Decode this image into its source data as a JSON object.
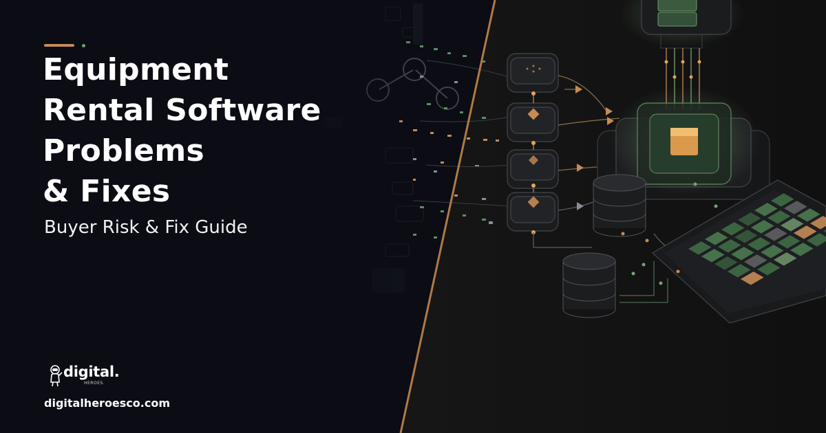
{
  "title_lines": [
    "Equipment",
    "Rental Software",
    "Problems",
    "& Fixes"
  ],
  "subtitle": "Buyer Risk & Fix Guide",
  "brand": {
    "logo_text": "digital.",
    "logo_subtext": "HEROES.",
    "website": "digitalheroesco.com"
  },
  "icons": {
    "logo_mark": "astronaut-icon"
  },
  "colors": {
    "background_left": "#0b0c14",
    "background_right": "#141414",
    "divider": "#b07a45",
    "accent_orange": "#c58b55",
    "accent_green": "#6da374",
    "text": "#ffffff"
  }
}
